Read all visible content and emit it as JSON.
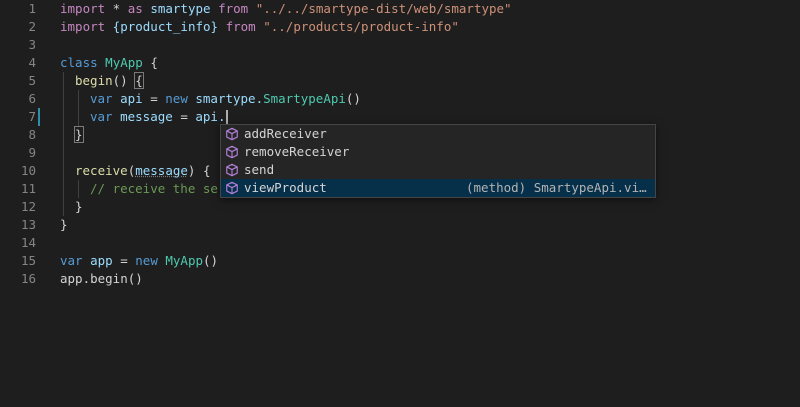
{
  "editor": {
    "line_numbers": [
      "1",
      "2",
      "3",
      "4",
      "5",
      "6",
      "7",
      "8",
      "9",
      "10",
      "11",
      "12",
      "13",
      "14",
      "15",
      "16"
    ],
    "lines": {
      "l1": {
        "kw_import": "import",
        "op": " * ",
        "kw_as": "as",
        "name": " smartype ",
        "kw_from": "from",
        "str": " \"../../smartype-dist/web/smartype\""
      },
      "l2": {
        "kw_import": "import",
        "braced": " {product_info} ",
        "kw_from": "from",
        "str": " \"../products/product-info\""
      },
      "l4": {
        "kw_class": "class",
        "cls": " MyApp",
        "rest": " {"
      },
      "l5": {
        "fn": "begin",
        "rest": "() ",
        "brace": "{"
      },
      "l6": {
        "kw_var": "var",
        "var": " api",
        "eq": " = ",
        "kw_new": "new",
        "ns": " smartype.",
        "cls": "SmartypeApi",
        "rest": "()"
      },
      "l7": {
        "kw_var": "var",
        "var": " message",
        "eq": " = ",
        "obj": "api."
      },
      "l8": {
        "brace": "}"
      },
      "l10": {
        "fn": "receive",
        "open": "(",
        "param": "message",
        "rest": ") {"
      },
      "l11": {
        "comment": "// receive the ser"
      },
      "l12": {
        "text": "}"
      },
      "l13": {
        "text": "}"
      },
      "l15": {
        "kw_var": "var",
        "var": " app",
        "eq": " = ",
        "kw_new": "new",
        "cls": " MyApp",
        "rest": "()"
      },
      "l16": {
        "text": "app.begin()"
      }
    }
  },
  "suggest": {
    "items": [
      {
        "label": "addReceiver",
        "icon": "method-cube-icon"
      },
      {
        "label": "removeReceiver",
        "icon": "method-cube-icon"
      },
      {
        "label": "send",
        "icon": "method-cube-icon"
      },
      {
        "label": "viewProduct",
        "icon": "method-cube-icon",
        "detail": "(method) SmartypeApi.vi…"
      }
    ]
  },
  "colors": {
    "background": "#1e1e1e",
    "keyword": "#569cd6",
    "string": "#ce9178",
    "class": "#4ec9b0",
    "function": "#dcdcaa",
    "variable": "#9cdcfe",
    "comment": "#6a9955",
    "selected": "#062f4a",
    "icon": "#b180d7"
  }
}
